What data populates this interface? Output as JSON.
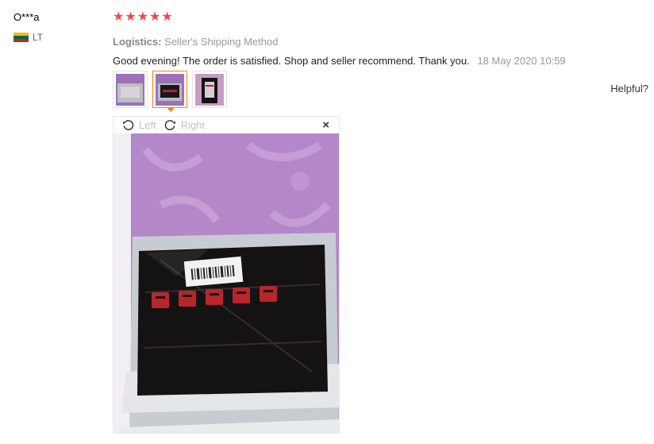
{
  "user": {
    "name": "O***a",
    "country": "LT",
    "flag_colors": [
      "#fdb913",
      "#006a44",
      "#c1272d"
    ]
  },
  "review": {
    "stars": 5,
    "star_color": "#f0484f",
    "logistics_label": "Logistics:",
    "logistics_value": "Seller's Shipping Method",
    "text": "Good evening! The order is satisfied. Shop and seller recommend. Thank you.",
    "date": "18 May 2020 10:59"
  },
  "thumbnails": {
    "count": 3,
    "active_index": 1
  },
  "helpful_label": "Helpful?",
  "viewer": {
    "rotate_left_label": "Left",
    "rotate_right_label": "Right",
    "close_icon": "×"
  }
}
